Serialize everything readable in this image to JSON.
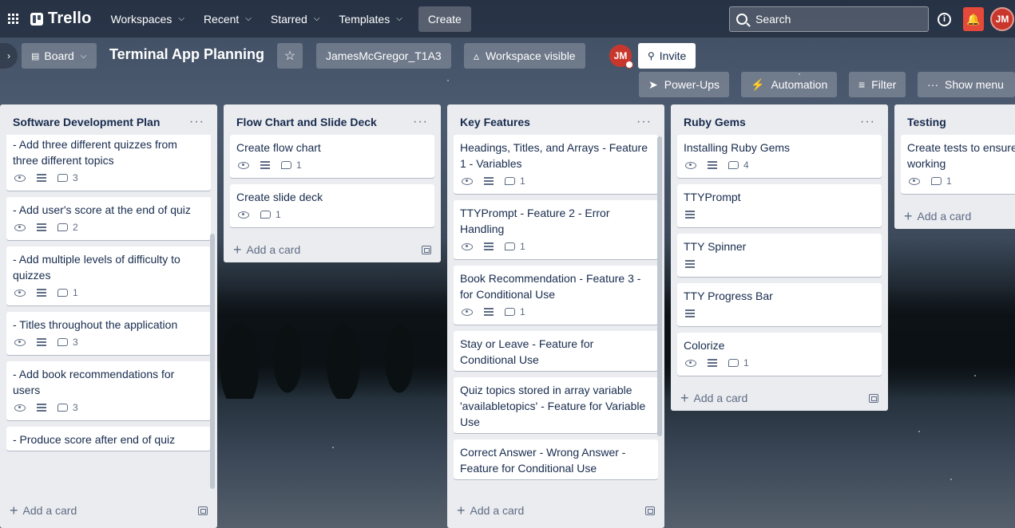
{
  "nav": {
    "logo": "Trello",
    "workspaces": "Workspaces",
    "recent": "Recent",
    "starred": "Starred",
    "templates": "Templates",
    "create": "Create",
    "search_placeholder": "Search",
    "avatar_initials": "JM"
  },
  "board": {
    "view": "Board",
    "title": "Terminal App Planning",
    "workspace": "JamesMcGregor_T1A3",
    "visibility": "Workspace visible",
    "invite": "Invite",
    "power_ups": "Power-Ups",
    "automation": "Automation",
    "filter": "Filter",
    "show_menu": "Show menu"
  },
  "lists": [
    {
      "title": "Software Development Plan",
      "add_card": "Add a card",
      "cards": [
        {
          "title": "- Add three different quizzes from three different topics",
          "comments": "3"
        },
        {
          "title": "- Add user's score at the end of quiz",
          "comments": "2"
        },
        {
          "title": "- Add multiple levels of difficulty to quizzes",
          "comments": "1"
        },
        {
          "title": "- Titles throughout the application",
          "comments": "3"
        },
        {
          "title": "- Add book recommendations for users",
          "comments": "3"
        },
        {
          "title": "- Produce score after end of quiz",
          "comments": ""
        }
      ]
    },
    {
      "title": "Flow Chart and Slide Deck",
      "add_card": "Add a card",
      "cards": [
        {
          "title": "Create flow chart",
          "comments": "1"
        },
        {
          "title": "Create slide deck",
          "comments": "1"
        }
      ]
    },
    {
      "title": "Key Features",
      "add_card": "Add a card",
      "cards": [
        {
          "title": "Headings, Titles, and Arrays - Feature 1 - Variables",
          "comments": "1"
        },
        {
          "title": "TTYPrompt - Feature 2 - Error Handling",
          "comments": "1"
        },
        {
          "title": "Book Recommendation - Feature 3 - for Conditional Use",
          "comments": "1"
        },
        {
          "title": "Stay or Leave - Feature for Conditional Use",
          "comments": ""
        },
        {
          "title": "Quiz topics stored in array variable 'availabletopics' - Feature for Variable Use",
          "comments": ""
        },
        {
          "title": "Correct Answer - Wrong Answer - Feature for Conditional Use",
          "comments": ""
        }
      ]
    },
    {
      "title": "Ruby Gems",
      "add_card": "Add a card",
      "cards": [
        {
          "title": "Installing Ruby Gems",
          "comments": "4"
        },
        {
          "title": "TTYPrompt",
          "comments": ""
        },
        {
          "title": "TTY Spinner",
          "comments": ""
        },
        {
          "title": "TTY Progress Bar",
          "comments": ""
        },
        {
          "title": "Colorize",
          "comments": "1"
        }
      ]
    },
    {
      "title": "Testing",
      "add_card": "Add a card",
      "cards": [
        {
          "title": "Create tests to ensure working",
          "comments": "1"
        }
      ]
    }
  ]
}
